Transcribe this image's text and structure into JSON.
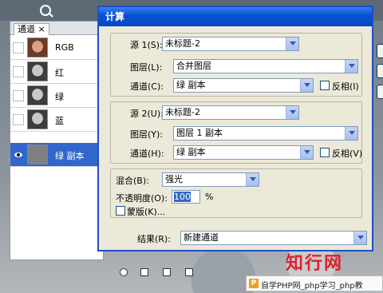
{
  "panel": {
    "tab_label": "通道",
    "tab_close": "×",
    "rows": [
      {
        "label": "RGB",
        "thumb": "color"
      },
      {
        "label": "红",
        "thumb": "gray"
      },
      {
        "label": "绿",
        "thumb": "gray"
      },
      {
        "label": "蓝",
        "thumb": "gray"
      },
      {
        "label": "绿 副本",
        "thumb": "flat"
      }
    ]
  },
  "dialog": {
    "title": "计算",
    "source1": {
      "label": "源 1(S):",
      "value": "未标题-2",
      "layer_label": "图层(L):",
      "layer_value": "合并图层",
      "channel_label": "通道(C):",
      "channel_value": "绿 副本",
      "invert_label": "反相(I)"
    },
    "source2": {
      "label": "源 2(U):",
      "value": "未标题-2",
      "layer_label": "图层(Y):",
      "layer_value": "图层 1 副本",
      "channel_label": "通道(H):",
      "channel_value": "绿 副本",
      "invert_label": "反相(V)"
    },
    "blend": {
      "label": "混合(B):",
      "value": "强光",
      "opacity_label": "不透明度(O):",
      "opacity_value": "100",
      "opacity_unit": "%",
      "mask_label": "蒙版(K)..."
    },
    "result": {
      "label": "结果(R):",
      "value": "新建通道"
    }
  },
  "watermark": {
    "text": "知行网",
    "caption": "自学PHP网_php学习_php教"
  }
}
